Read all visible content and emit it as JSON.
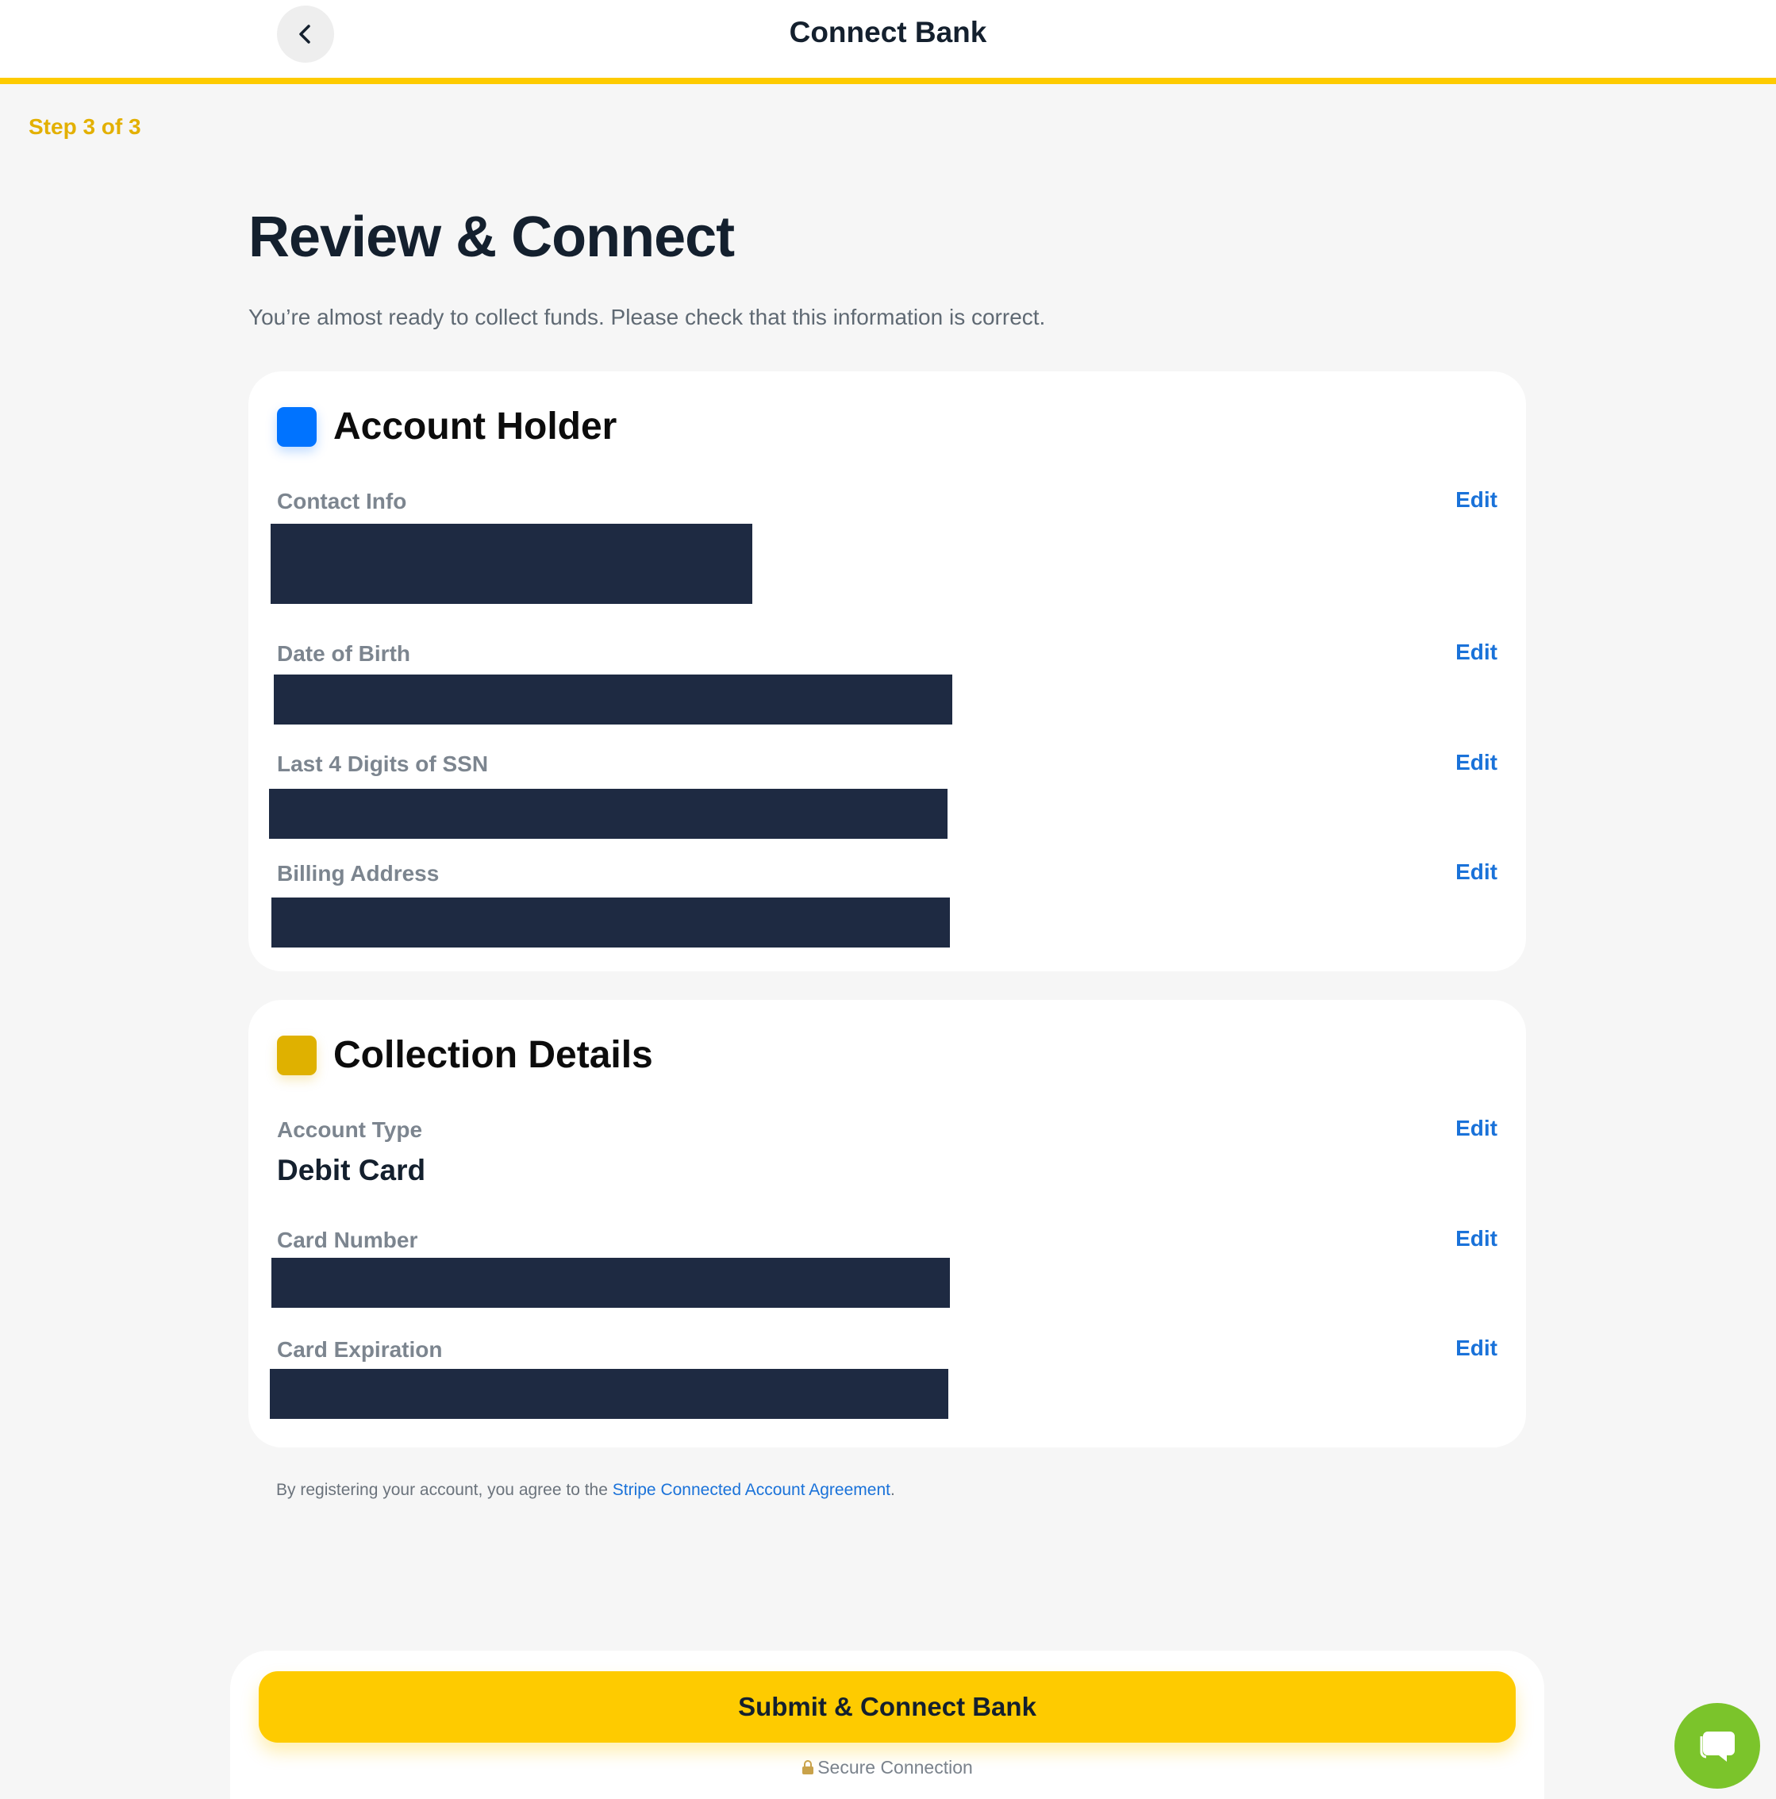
{
  "header": {
    "title": "Connect Bank",
    "back_icon": "chevron-left-icon"
  },
  "step": "Step 3 of 3",
  "page": {
    "title": "Review & Connect",
    "subtitle": "You’re almost ready to collect funds. Please check that this information is correct."
  },
  "account_holder": {
    "title": "Account Holder",
    "accent_color": "#0073ff",
    "fields": [
      {
        "label": "Contact Info",
        "edit": "Edit"
      },
      {
        "label": "Date of Birth",
        "edit": "Edit"
      },
      {
        "label": "Last 4 Digits of SSN",
        "edit": "Edit"
      },
      {
        "label": "Billing Address",
        "edit": "Edit"
      }
    ]
  },
  "collection_details": {
    "title": "Collection Details",
    "accent_color": "#dfb100",
    "fields": [
      {
        "label": "Account Type",
        "value": "Debit Card",
        "edit": "Edit"
      },
      {
        "label": "Card Number",
        "edit": "Edit"
      },
      {
        "label": "Card Expiration",
        "edit": "Edit"
      }
    ]
  },
  "agreement": {
    "prefix": "By registering your account, you agree to the ",
    "link": "Stripe Connected Account Agreement",
    "suffix": "."
  },
  "footer": {
    "submit_label": "Submit & Connect Bank",
    "secure_label": "Secure Connection",
    "secure_icon": "lock-icon"
  },
  "chat": {
    "icon": "chat-bubble-icon"
  },
  "colors": {
    "brand_yellow": "#fecb00",
    "text_dark": "#14202e",
    "link_blue": "#1a72d9",
    "redaction": "#1e2a42",
    "chat_green": "#7bc42b"
  }
}
